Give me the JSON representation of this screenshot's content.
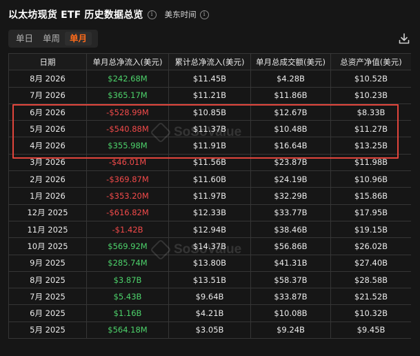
{
  "header": {
    "title": "以太坊现货 ETF 历史数据总览",
    "info_glyph": "i",
    "timezone_label": "美东时间"
  },
  "tabs": [
    {
      "label": "单日",
      "active": false
    },
    {
      "label": "单周",
      "active": false
    },
    {
      "label": "单月",
      "active": true
    }
  ],
  "table": {
    "headers": [
      "日期",
      "单月总净流入(美元)",
      "累计总净流入(美元)",
      "单月总成交额(美元)",
      "总资产净值(美元)"
    ],
    "rows": [
      {
        "date": "8月 2026",
        "net": "$242.68M",
        "sign": "pos",
        "cum": "$11.45B",
        "vol": "$4.28B",
        "nav": "$10.52B"
      },
      {
        "date": "7月 2026",
        "net": "$365.17M",
        "sign": "pos",
        "cum": "$11.21B",
        "vol": "$11.86B",
        "nav": "$10.23B"
      },
      {
        "date": "6月 2026",
        "net": "-$528.99M",
        "sign": "neg",
        "cum": "$10.85B",
        "vol": "$12.67B",
        "nav": "$8.33B"
      },
      {
        "date": "5月 2026",
        "net": "-$540.88M",
        "sign": "neg",
        "cum": "$11.37B",
        "vol": "$10.48B",
        "nav": "$11.27B"
      },
      {
        "date": "4月 2026",
        "net": "$355.98M",
        "sign": "pos",
        "cum": "$11.91B",
        "vol": "$16.64B",
        "nav": "$13.25B"
      },
      {
        "date": "3月 2026",
        "net": "-$46.01M",
        "sign": "neg",
        "cum": "$11.56B",
        "vol": "$23.87B",
        "nav": "$11.98B"
      },
      {
        "date": "2月 2026",
        "net": "-$369.87M",
        "sign": "neg",
        "cum": "$11.60B",
        "vol": "$24.19B",
        "nav": "$10.96B"
      },
      {
        "date": "1月 2026",
        "net": "-$353.20M",
        "sign": "neg",
        "cum": "$11.97B",
        "vol": "$32.29B",
        "nav": "$15.86B"
      },
      {
        "date": "12月 2025",
        "net": "-$616.82M",
        "sign": "neg",
        "cum": "$12.33B",
        "vol": "$33.77B",
        "nav": "$17.95B"
      },
      {
        "date": "11月 2025",
        "net": "-$1.42B",
        "sign": "neg",
        "cum": "$12.94B",
        "vol": "$38.46B",
        "nav": "$19.15B"
      },
      {
        "date": "10月 2025",
        "net": "$569.92M",
        "sign": "pos",
        "cum": "$14.37B",
        "vol": "$56.86B",
        "nav": "$26.02B"
      },
      {
        "date": "9月 2025",
        "net": "$285.74M",
        "sign": "pos",
        "cum": "$13.80B",
        "vol": "$41.31B",
        "nav": "$27.40B"
      },
      {
        "date": "8月 2025",
        "net": "$3.87B",
        "sign": "pos",
        "cum": "$13.51B",
        "vol": "$58.37B",
        "nav": "$28.58B"
      },
      {
        "date": "7月 2025",
        "net": "$5.43B",
        "sign": "pos",
        "cum": "$9.64B",
        "vol": "$33.87B",
        "nav": "$21.52B"
      },
      {
        "date": "6月 2025",
        "net": "$1.16B",
        "sign": "pos",
        "cum": "$4.21B",
        "vol": "$10.08B",
        "nav": "$10.32B"
      },
      {
        "date": "5月 2025",
        "net": "$564.18M",
        "sign": "pos",
        "cum": "$3.05B",
        "vol": "$9.24B",
        "nav": "$9.45B"
      }
    ]
  },
  "watermark": {
    "text": "SoSoValue"
  },
  "colors": {
    "accent": "#ff6b1a",
    "positive": "#4dd36b",
    "negative": "#f24a4a",
    "highlight_box": "#e2453c",
    "background": "#161616",
    "grid": "#363636"
  }
}
